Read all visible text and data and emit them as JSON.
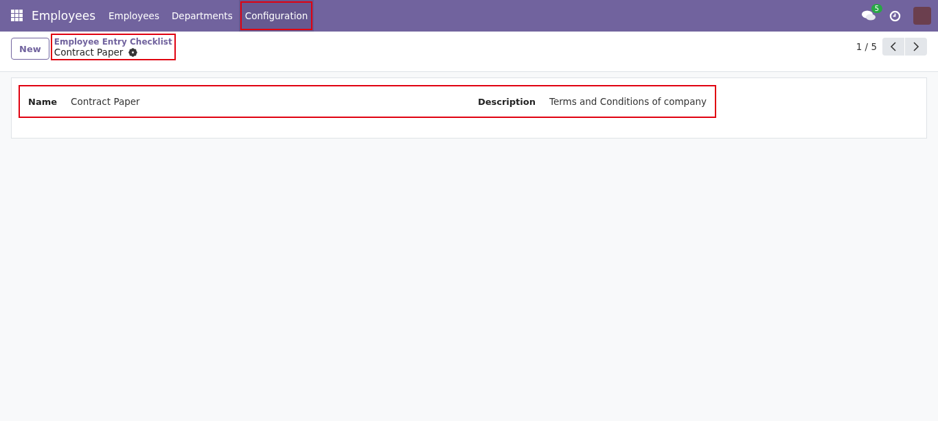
{
  "navbar": {
    "app_title": "Employees",
    "menu": [
      {
        "label": "Employees",
        "selected": false,
        "highlighted": false
      },
      {
        "label": "Departments",
        "selected": false,
        "highlighted": false
      },
      {
        "label": "Configuration",
        "selected": true,
        "highlighted": true
      }
    ],
    "messages_badge": "5"
  },
  "control_panel": {
    "new_button": "New",
    "breadcrumb": {
      "parent": "Employee Entry Checklist",
      "current": "Contract Paper",
      "highlighted": true
    },
    "pager": "1 / 5"
  },
  "form": {
    "highlighted": true,
    "fields": [
      {
        "label": "Name",
        "value": "Contract Paper"
      },
      {
        "label": "Description",
        "value": "Terms and Conditions of company"
      }
    ]
  }
}
